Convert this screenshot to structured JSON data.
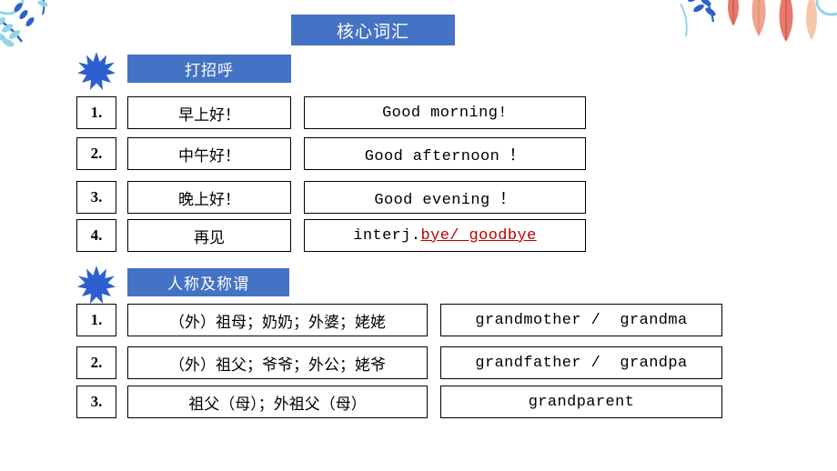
{
  "title": {
    "text": "核心词汇"
  },
  "colors": {
    "accent": "#4472c4",
    "star": "#2e5fd0",
    "highlight": "#c00000",
    "border": "#000000"
  },
  "sections": [
    {
      "name": "greetings",
      "header": "打招呼",
      "star_icon": "star-burst-icon",
      "rows": [
        {
          "num": "1.",
          "cn": "早上好！",
          "en": "Good morning!",
          "en_plain": "Good morning!",
          "en_highlight": ""
        },
        {
          "num": "2.",
          "cn": "中午好！",
          "en": "Good afternoon ！",
          "en_plain": "Good afternoon ！",
          "en_highlight": ""
        },
        {
          "num": "3.",
          "cn": "晚上好！",
          "en": "Good evening ！",
          "en_plain": "Good evening ！",
          "en_highlight": ""
        },
        {
          "num": "4.",
          "cn": "再见",
          "en": "interj.bye/ goodbye",
          "en_plain": "interj.",
          "en_highlight": "bye/ goodbye"
        }
      ]
    },
    {
      "name": "persons-and-titles",
      "header": "人称及称谓",
      "star_icon": "star-burst-icon",
      "rows": [
        {
          "num": "1.",
          "cn": "（外）祖母；奶奶；外婆；姥姥",
          "en": "grandmother /  grandma",
          "en_plain": "grandmother /  grandma",
          "en_highlight": ""
        },
        {
          "num": "2.",
          "cn": "（外）祖父；爷爷；外公；姥爷",
          "en": "grandfather /  grandpa",
          "en_plain": "grandfather /  grandpa",
          "en_highlight": ""
        },
        {
          "num": "3.",
          "cn": "祖父（母）；外祖父（母）",
          "en": "grandparent",
          "en_plain": "grandparent",
          "en_highlight": ""
        }
      ]
    }
  ]
}
